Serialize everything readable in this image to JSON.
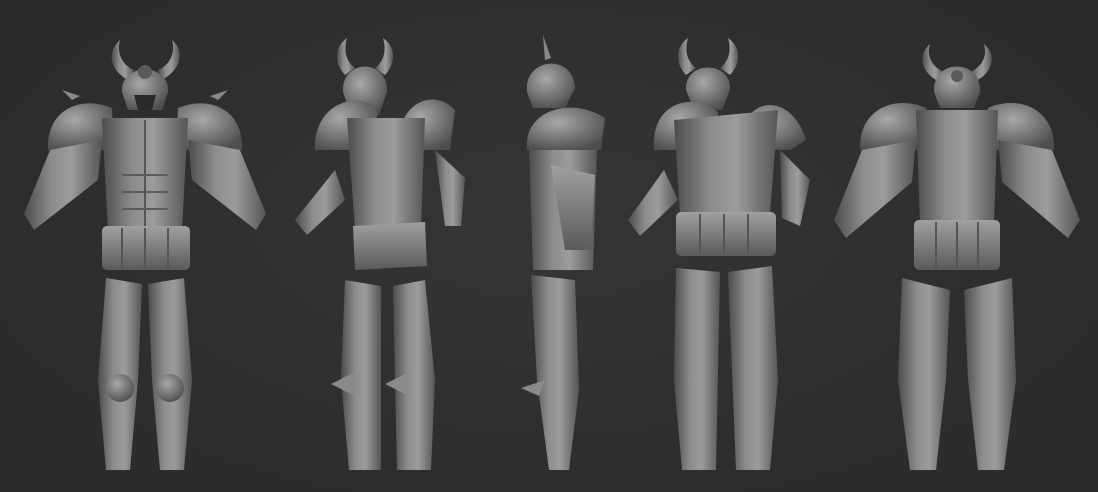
{
  "scene": {
    "subject": "armor",
    "colors": {
      "background": "#2f2f2f",
      "clay_light": "#9a9a9a",
      "clay_mid": "#767676",
      "clay_dark": "#4a4a4a",
      "shadow": "#1e1e1e"
    },
    "views": [
      {
        "name": "front-view"
      },
      {
        "name": "three-quarter-front-view"
      },
      {
        "name": "side-view"
      },
      {
        "name": "three-quarter-back-view"
      },
      {
        "name": "back-view"
      }
    ]
  }
}
